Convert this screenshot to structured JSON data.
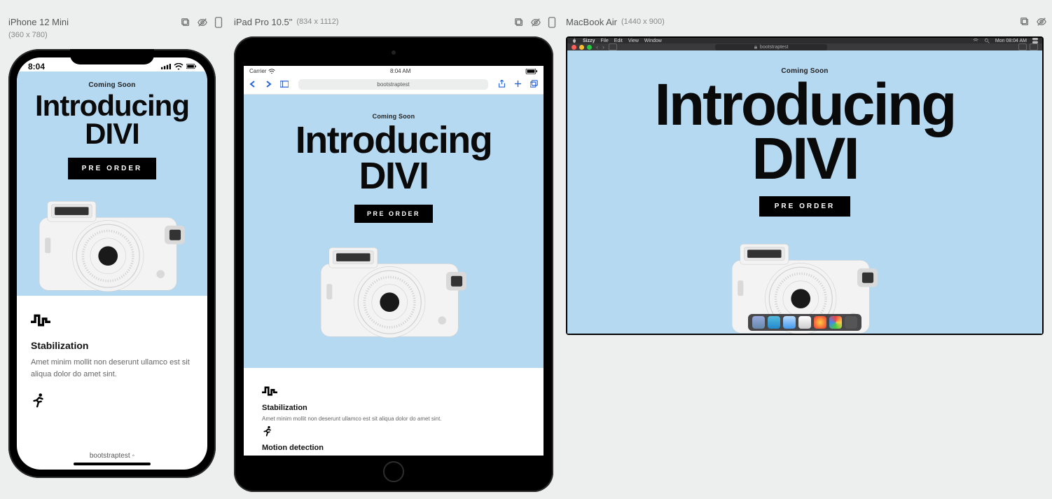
{
  "page": {
    "coming_soon": "Coming Soon",
    "title_line1": "Introducing",
    "title_line2": "DIVI",
    "cta": "PRE ORDER",
    "feature1_title": "Stabilization",
    "feature1_text": "Amet minim mollit non deserunt ullamco est sit aliqua dolor do amet sint.",
    "feature2_title": "Motion detection"
  },
  "devices": {
    "iphone": {
      "name": "iPhone 12 Mini",
      "dims": "(360 x 780)",
      "status_time": "8:04",
      "tab_url": "bootstraptest"
    },
    "ipad": {
      "name": "iPad Pro 10.5\"",
      "dims": "(834 x 1112)",
      "status_carrier": "Carrier",
      "status_time": "8:04 AM",
      "url": "bootstraptest"
    },
    "mac": {
      "name": "MacBook Air",
      "dims": "(1440 x 900)",
      "menubar_app": "Sizzy",
      "menubar_items": [
        "File",
        "Edit",
        "View",
        "Window"
      ],
      "menubar_time": "Mon 08:04 AM",
      "browser_url": "bootstraptest"
    }
  }
}
